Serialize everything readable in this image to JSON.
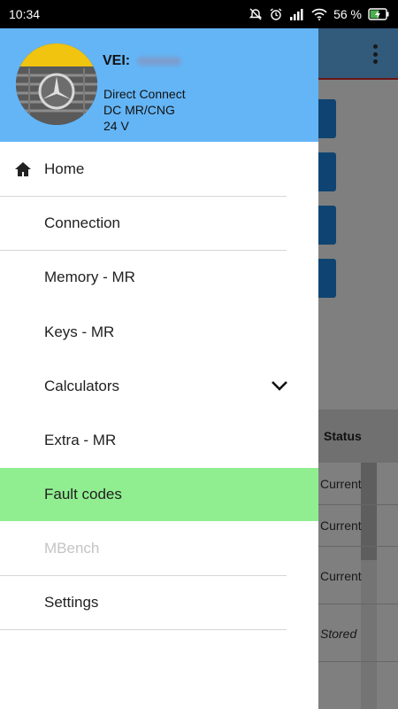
{
  "status_bar": {
    "time": "10:34",
    "battery": "56 %",
    "icons": [
      "alarm-off-icon",
      "alarm-clock-icon",
      "signal-icon",
      "wifi-icon",
      "battery-charging-icon"
    ]
  },
  "background": {
    "menu_icon": "more-vert-icon",
    "table_header_status": "Status",
    "rows": [
      "Current",
      "Current",
      "Current",
      "Stored"
    ]
  },
  "drawer": {
    "header": {
      "vei_label": "VEI:",
      "connection_type": "Direct Connect",
      "system": "DC MR/CNG",
      "voltage": "24 V"
    },
    "items": [
      {
        "label": "Home",
        "icon": "home-icon"
      },
      {
        "label": "Connection"
      },
      {
        "label": "Memory - MR"
      },
      {
        "label": "Keys - MR"
      },
      {
        "label": "Calculators",
        "icon": "chevron-down-icon"
      },
      {
        "label": "Extra - MR"
      },
      {
        "label": "Fault codes",
        "selected": true
      },
      {
        "label": "MBench",
        "disabled": true
      },
      {
        "label": "Settings"
      }
    ],
    "colors": {
      "header": "#64b5f6",
      "selected": "#90ee90",
      "disabled_text": "#c4c4c4"
    }
  }
}
